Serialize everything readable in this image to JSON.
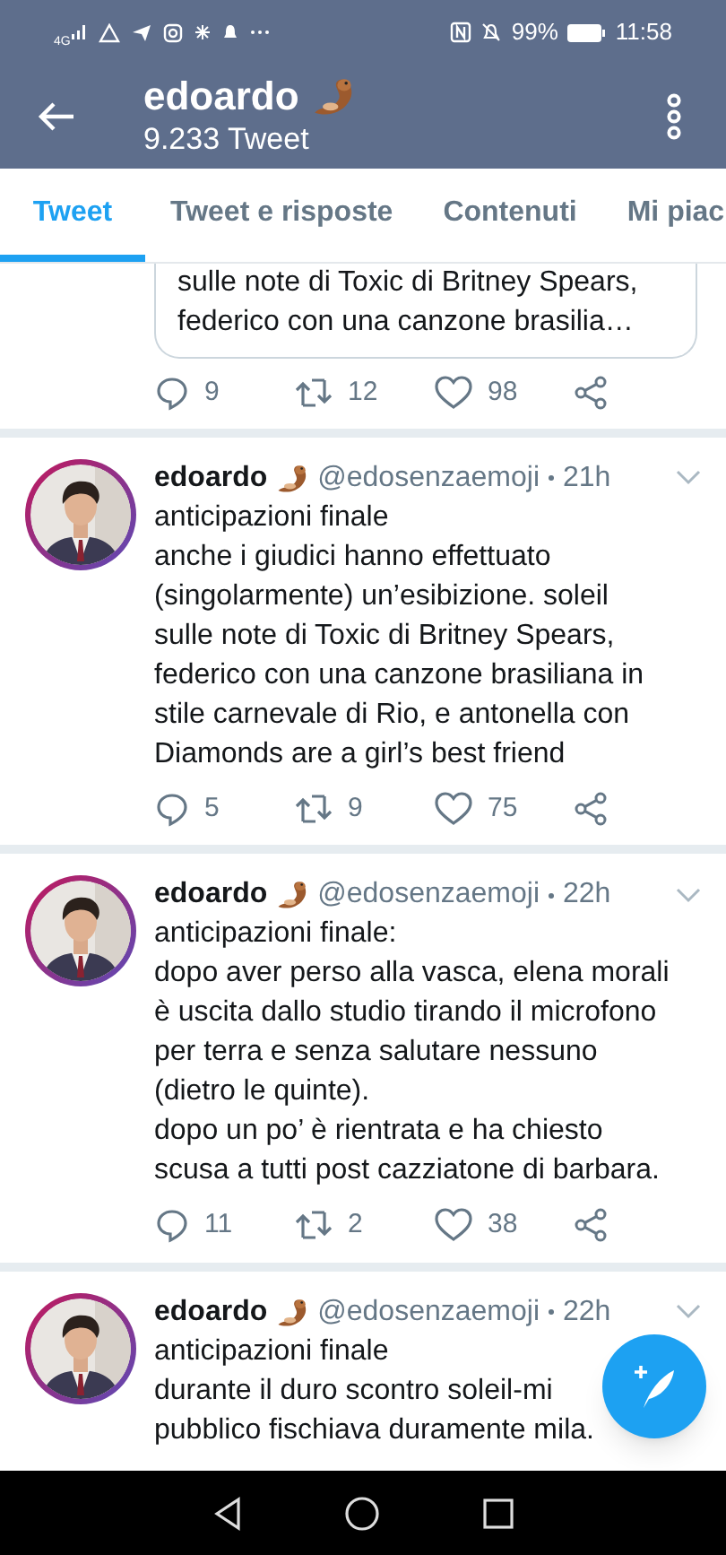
{
  "status_bar": {
    "network": "4G",
    "battery": "99%",
    "time": "11:58"
  },
  "header": {
    "name": "edoardo",
    "tweet_count": "9.233 Tweet"
  },
  "tabs": [
    {
      "label": "Tweet",
      "selected": true
    },
    {
      "label": "Tweet e risposte",
      "selected": false
    },
    {
      "label": "Contenuti",
      "selected": false
    },
    {
      "label": "Mi piac",
      "selected": false
    }
  ],
  "top_partial": {
    "quote_text": "sulle note di Toxic di Britney Spears,\nfederico con una canzone brasilia…",
    "replies": "9",
    "retweets": "12",
    "likes": "98"
  },
  "tweets": [
    {
      "name": "edoardo",
      "handle": "@edosenzaemoji",
      "time": "21h",
      "text": "anticipazioni finale\nanche i giudici hanno effettuato\n(singolarmente) un’esibizione. soleil\nsulle note di Toxic di Britney Spears,\nfederico con una canzone brasiliana in\nstile carnevale di Rio, e antonella con\nDiamonds are a girl’s best friend",
      "replies": "5",
      "retweets": "9",
      "likes": "75"
    },
    {
      "name": "edoardo",
      "handle": "@edosenzaemoji",
      "time": "22h",
      "text": "anticipazioni finale:\ndopo aver perso alla vasca, elena morali\nè uscita dallo studio tirando il microfono\nper terra e senza salutare nessuno\n(dietro le quinte).\ndopo un po’ è rientrata e ha chiesto\nscusa a tutti post cazziatone di barbara.",
      "replies": "11",
      "retweets": "2",
      "likes": "38"
    },
    {
      "name": "edoardo",
      "handle": "@edosenzaemoji",
      "time": "22h",
      "text": "anticipazioni finale\ndurante il duro scontro soleil-mi\npubblico fischiava duramente mila."
    }
  ]
}
